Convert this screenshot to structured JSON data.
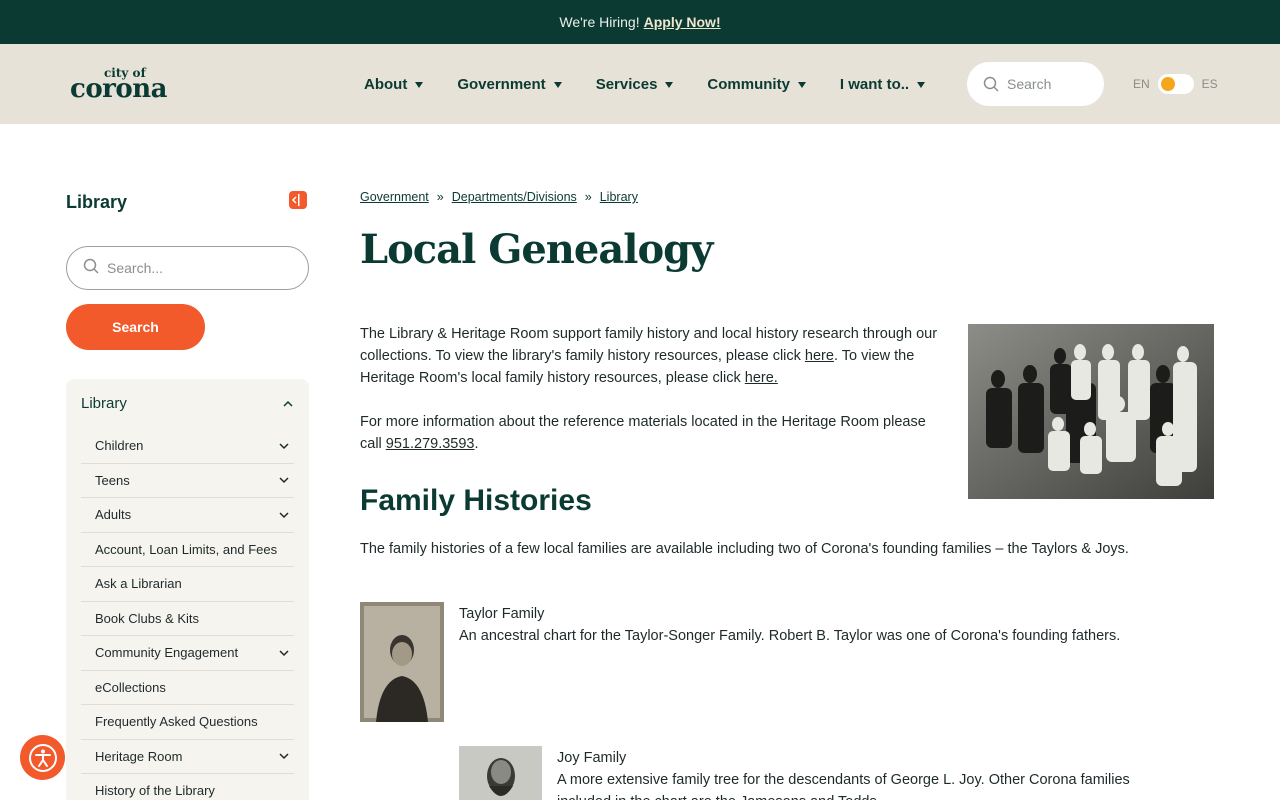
{
  "banner": {
    "text": "We're Hiring!",
    "link": "Apply Now!"
  },
  "logo": {
    "line1": "city of",
    "line2": "corona"
  },
  "nav": [
    {
      "label": "About"
    },
    {
      "label": "Government"
    },
    {
      "label": "Services"
    },
    {
      "label": "Community"
    },
    {
      "label": "I want to.."
    }
  ],
  "header_search": {
    "placeholder": "Search"
  },
  "language": {
    "left": "EN",
    "right": "ES",
    "active": "EN"
  },
  "sidebar": {
    "title": "Library",
    "search_placeholder": "Search...",
    "search_button": "Search",
    "section": "Library",
    "items": [
      {
        "label": "Children",
        "expandable": true
      },
      {
        "label": "Teens",
        "expandable": true
      },
      {
        "label": "Adults",
        "expandable": true
      },
      {
        "label": "Account, Loan Limits, and Fees",
        "expandable": false
      },
      {
        "label": "Ask a Librarian",
        "expandable": false
      },
      {
        "label": "Book Clubs & Kits",
        "expandable": false
      },
      {
        "label": "Community Engagement",
        "expandable": true
      },
      {
        "label": "eCollections",
        "expandable": false
      },
      {
        "label": "Frequently Asked Questions",
        "expandable": false
      },
      {
        "label": "Heritage Room",
        "expandable": true
      },
      {
        "label": "History of the Library",
        "expandable": false
      }
    ]
  },
  "breadcrumb": [
    {
      "label": "Government"
    },
    {
      "label": "Departments/Divisions"
    },
    {
      "label": "Library"
    }
  ],
  "breadcrumb_separator": "»",
  "page": {
    "title": "Local Genealogy",
    "intro": {
      "p1_before": "The Library & Heritage Room support family history and local history research through our collections.  To view the library's family history resources, please click ",
      "p1_link1": "here",
      "p1_middle": ".   To view the Heritage Room's local family history resources, please click ",
      "p1_link2": "here.",
      "p2_before": "For more information about the reference materials located in the Heritage Room please call ",
      "p2_phone": "951.279.3593",
      "p2_after": "."
    },
    "section_title": "Family Histories",
    "section_desc": "The family histories of a few local families are available including two of Corona's founding families – the Taylors & Joys.",
    "entries": [
      {
        "name": "Taylor Family",
        "desc": "An ancestral chart for the Taylor-Songer Family. Robert B. Taylor was one of Corona's founding fathers."
      },
      {
        "name": "Joy Family",
        "desc": "A more extensive family tree for the descendants of George L. Joy. Other Corona families included in the chart are the Jamesons and Todds."
      }
    ]
  },
  "colors": {
    "banner": "#0b3a33",
    "header": "#e7e2d8",
    "accent": "#f2592b",
    "title": "#0b3a33"
  }
}
